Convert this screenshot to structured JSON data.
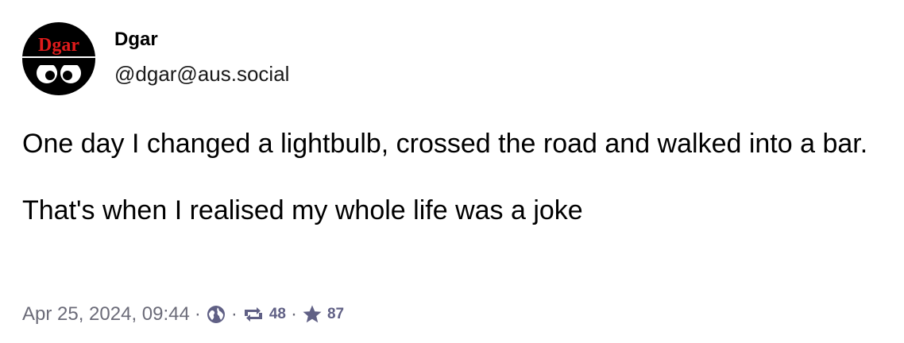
{
  "author": {
    "display_name": "Dgar",
    "handle": "@dgar@aus.social",
    "avatar_text": "Dgar"
  },
  "post": {
    "paragraphs": [
      "One day I changed a lightbulb, crossed the road and walked into a bar.",
      "That's when I realised my whole life was a joke"
    ]
  },
  "meta": {
    "timestamp": "Apr 25, 2024, 09:44",
    "separator": "·",
    "visibility_icon": "globe-icon",
    "boosts": "48",
    "boost_icon": "boost-icon",
    "favourites": "87",
    "favourite_icon": "star-icon"
  },
  "colors": {
    "avatar_bg": "#000000",
    "avatar_text": "#e01b1b",
    "meta_text": "#6b6b78",
    "count_text": "#606085"
  }
}
